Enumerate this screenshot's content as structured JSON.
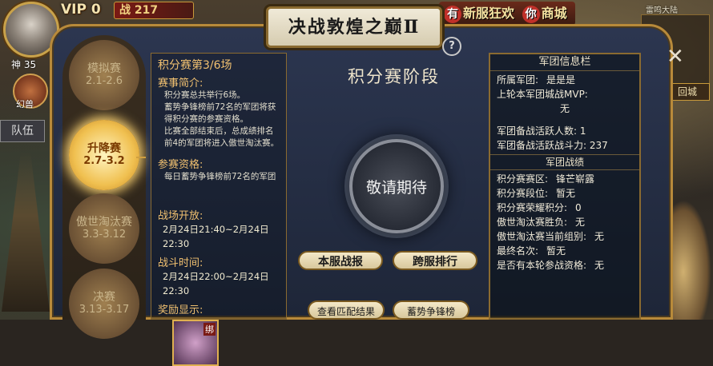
{
  "hud": {
    "vip": "VIP 0",
    "power": "战 217",
    "level": "神 35",
    "side_label": "幻兽",
    "team_tab": "队伍",
    "event_badge": "有",
    "event_text": "新服狂欢",
    "shop_badge": "你",
    "shop_text": "商城",
    "map_label": "雷鸣大陆",
    "return_label": "回城"
  },
  "window": {
    "title": "决战敦煌之巅Ⅱ",
    "help": "?"
  },
  "stages": [
    {
      "name": "模拟赛",
      "dates": "2.1-2.6",
      "active": false
    },
    {
      "name": "升降赛",
      "dates": "2.7-3.2",
      "active": true
    },
    {
      "name": "傲世淘汰赛",
      "dates": "3.3-3.12",
      "active": false
    },
    {
      "name": "决赛",
      "dates": "3.13-3.17",
      "active": false
    }
  ],
  "info": {
    "title": "积分赛第3/6场",
    "intro_h": "赛事简介:",
    "intro_1": "积分赛总共举行6场。",
    "intro_2": "蓄势争锋榜前72名的军团将获得积分赛的参赛资格。",
    "intro_3": "比赛全部结束后，总成绩排名前4的军团将进入傲世淘汰赛。",
    "qual_h": "参赛资格:",
    "qual_1": "每日蓄势争锋榜前72名的军团",
    "open_h": "战场开放:",
    "open_1": "2月24日21:40~2月24日22:30",
    "fight_h": "战斗时间:",
    "fight_1": "2月24日22:00~2月24日22:30",
    "reward_h": "奖励显示:",
    "reward_tag": "绑"
  },
  "center": {
    "stage_title": "积分赛阶段",
    "circle_text": "敬请期待",
    "btn_local": "本服战报",
    "btn_cross": "跨服排行",
    "btn_match": "查看匹配结果",
    "btn_rank": "蓄势争锋榜"
  },
  "legion": {
    "head": "军团信息栏",
    "belong_label": "所属军团:",
    "belong_value": "是是是",
    "mvp_label": "上轮本军团城战MVP:",
    "mvp_value": "无",
    "active_label": "军团备战活跃人数:",
    "active_value": "1",
    "power_label": "军团备战活跃战斗力:",
    "power_value": "237",
    "record_head": "军团战绩",
    "zone_label": "积分赛赛区:",
    "zone_value": "锋芒崭露",
    "seg_label": "积分赛段位:",
    "seg_value": "暂无",
    "honor_label": "积分赛荣耀积分:",
    "honor_value": "0",
    "win_label": "傲世淘汰赛胜负:",
    "win_value": "无",
    "group_label": "傲世淘汰赛当前组别:",
    "group_value": "无",
    "final_label": "最终名次:",
    "final_value": "暂无",
    "qual_label": "是否有本轮参战资格:",
    "qual_value": "无"
  }
}
